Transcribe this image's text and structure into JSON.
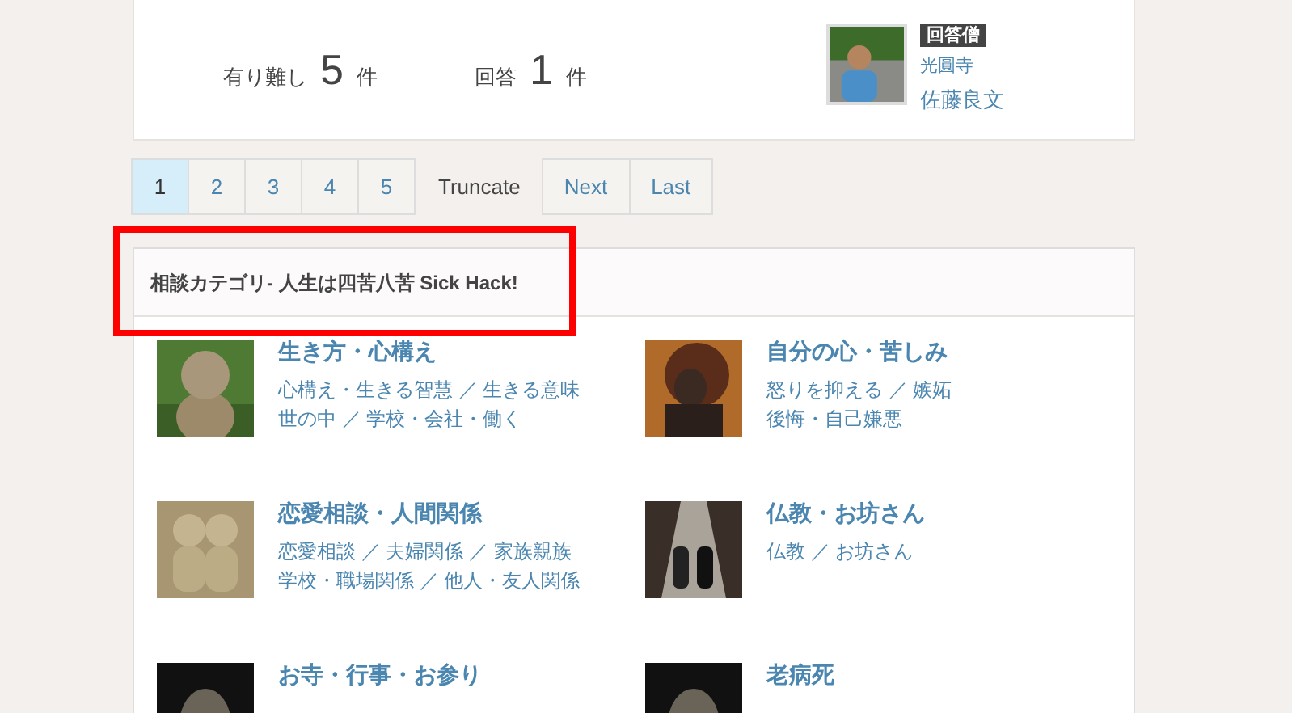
{
  "stats": [
    {
      "label": "有り難し",
      "value": "5",
      "unit": "件"
    },
    {
      "label": "回答",
      "value": "1",
      "unit": "件"
    }
  ],
  "answerer": {
    "badge": "回答僧",
    "temple": "光圓寺",
    "name": "佐藤良文"
  },
  "pagination": [
    {
      "label": "1",
      "kind": "page",
      "selected": true
    },
    {
      "label": "2",
      "kind": "page",
      "selected": false
    },
    {
      "label": "3",
      "kind": "page",
      "selected": false
    },
    {
      "label": "4",
      "kind": "page",
      "selected": false
    },
    {
      "label": "5",
      "kind": "page",
      "selected": false
    },
    {
      "label": "Truncate",
      "kind": "gap"
    },
    {
      "label": "Next",
      "kind": "page",
      "selected": false
    },
    {
      "label": "Last",
      "kind": "page",
      "selected": false
    }
  ],
  "panel": {
    "title": "相談カテゴリ- 人生は四苦八苦 Sick Hack!"
  },
  "categories": [
    {
      "title": "生き方・心構え",
      "lines": [
        "心構え・生きる智慧 ／ 生きる意味",
        "世の中 ／ 学校・会社・働く"
      ]
    },
    {
      "title": "自分の心・苦しみ",
      "lines": [
        "怒りを抑える ／ 嫉妬",
        "後悔・自己嫌悪"
      ]
    },
    {
      "title": "恋愛相談・人間関係",
      "lines": [
        "恋愛相談 ／ 夫婦関係 ／ 家族親族",
        "学校・職場関係 ／ 他人・友人関係"
      ]
    },
    {
      "title": "仏教・お坊さん",
      "lines": [
        "仏教 ／ お坊さん"
      ]
    },
    {
      "title": "お寺・行事・お参り"
    },
    {
      "title": "老病死"
    }
  ]
}
